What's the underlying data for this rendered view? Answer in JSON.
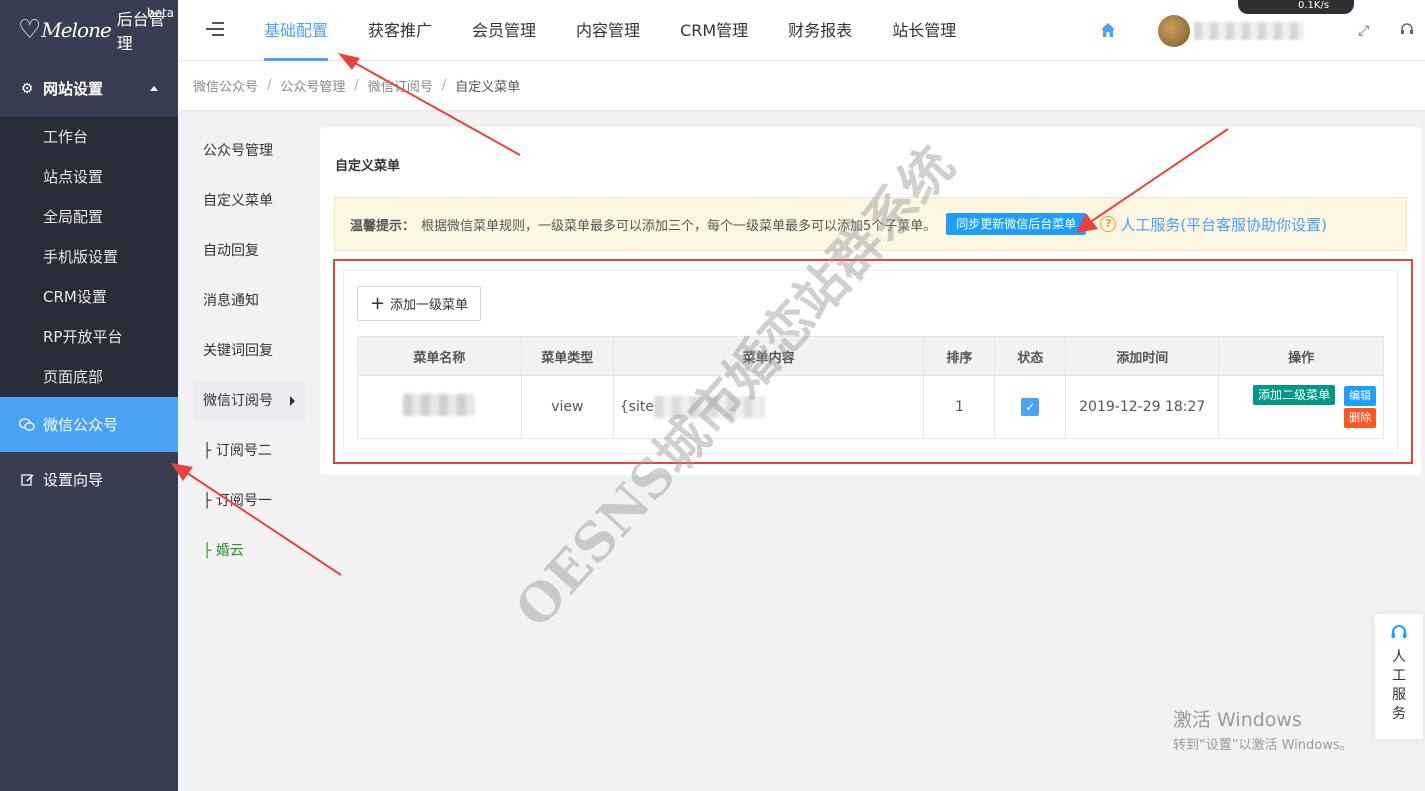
{
  "brand": {
    "logo_script": "Melone",
    "title": "后台管理",
    "badge": "beta"
  },
  "sidebar": {
    "group": {
      "label": "网站设置",
      "icon": "gear-icon",
      "expanded": true
    },
    "sub_items": [
      "工作台",
      "站点设置",
      "全局配置",
      "手机版设置",
      "CRM设置",
      "RP开放平台",
      "页面底部"
    ],
    "items": [
      {
        "label": "微信公众号",
        "icon": "wechat-icon",
        "active": true
      },
      {
        "label": "设置向导",
        "icon": "edit-icon",
        "active": false
      }
    ]
  },
  "header": {
    "tabs": [
      "基础配置",
      "获客推广",
      "会员管理",
      "内容管理",
      "CRM管理",
      "财务报表",
      "站长管理"
    ],
    "active_tab": "基础配置",
    "net_speed": "0.1K/s"
  },
  "breadcrumb": [
    "微信公众号",
    "公众号管理",
    "微信订阅号",
    "自定义菜单"
  ],
  "submenu": [
    {
      "label": "公众号管理"
    },
    {
      "label": "自定义菜单"
    },
    {
      "label": "自动回复"
    },
    {
      "label": "消息通知"
    },
    {
      "label": "关键词回复"
    },
    {
      "label": "微信订阅号",
      "active": true
    },
    {
      "label": "├ 订阅号二"
    },
    {
      "label": "├ 订阅号一"
    },
    {
      "label": "├ 婚云",
      "highlight": true
    }
  ],
  "panel": {
    "title": "自定义菜单",
    "tip_label": "温馨提示：",
    "tip_text": "根据微信菜单规则，一级菜单最多可以添加三个，每个一级菜单最多可以添加5个子菜单。",
    "sync_button": "同步更新微信后台菜单",
    "help_text": "人工服务(平台客服协助你设置)",
    "add_button": "添加一级菜单",
    "table": {
      "headers": [
        "菜单名称",
        "菜单类型",
        "菜单内容",
        "排序",
        "状态",
        "添加时间",
        "操作"
      ],
      "rows": [
        {
          "type": "view",
          "content_prefix": "{site",
          "sort": "1",
          "enabled": true,
          "time": "2019-12-29 18:27"
        }
      ],
      "op_add": "添加二级菜单",
      "op_edit": "编辑",
      "op_delete": "删除"
    }
  },
  "watermark": "OESNS城市婚恋站群系统",
  "service": {
    "label": "人工服务"
  },
  "windows": {
    "line1": "激活 Windows",
    "line2": "转到“设置”以激活 Windows。"
  },
  "colors": {
    "sidebar_bg": "#393d52",
    "accent": "#4ba1f4",
    "annotation_red": "#e64340"
  }
}
